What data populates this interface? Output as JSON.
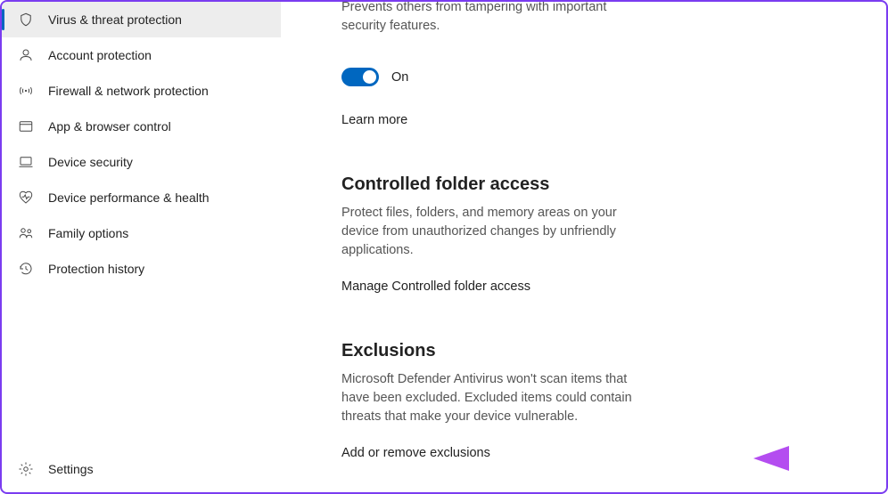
{
  "sidebar": {
    "items": [
      {
        "label": "Virus & threat protection"
      },
      {
        "label": "Account protection"
      },
      {
        "label": "Firewall & network protection"
      },
      {
        "label": "App & browser control"
      },
      {
        "label": "Device security"
      },
      {
        "label": "Device performance & health"
      },
      {
        "label": "Family options"
      },
      {
        "label": "Protection history"
      }
    ],
    "settings_label": "Settings"
  },
  "tamper": {
    "desc": "Prevents others from tampering with important security features.",
    "toggle_state": "On",
    "learn_more": "Learn more"
  },
  "cfa": {
    "heading": "Controlled folder access",
    "desc": "Protect files, folders, and memory areas on your device from unauthorized changes by unfriendly applications.",
    "manage": "Manage Controlled folder access"
  },
  "exclusions": {
    "heading": "Exclusions",
    "desc": "Microsoft Defender Antivirus won't scan items that have been excluded. Excluded items could contain threats that make your device vulnerable.",
    "action": "Add or remove exclusions"
  }
}
